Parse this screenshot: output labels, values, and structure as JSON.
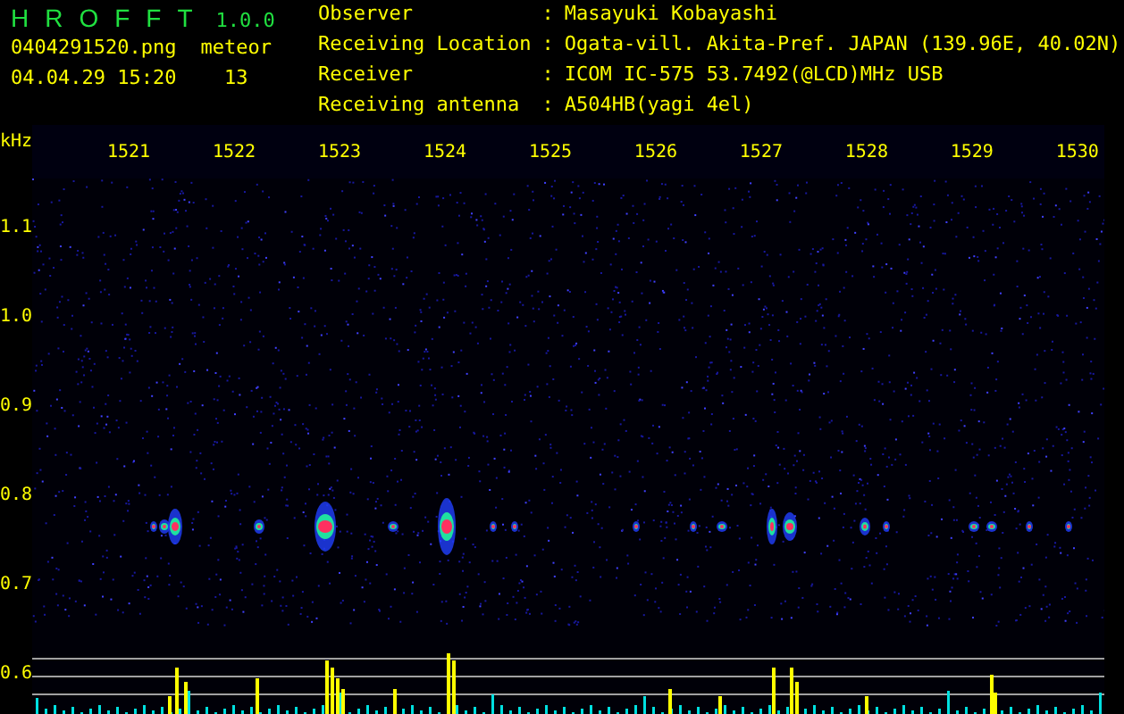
{
  "app": {
    "title": "HROFFT",
    "version": "1.0.0"
  },
  "file": {
    "name": "0404291520.png",
    "datetime": "04.04.29 15:20"
  },
  "meteor": {
    "label": "meteor",
    "count": "13"
  },
  "info": [
    {
      "label": "Observer",
      "separator": ":",
      "value": "Masayuki Kobayashi"
    },
    {
      "label": "Receiving Location",
      "separator": ":",
      "value": "Ogata-vill. Akita-Pref. JAPAN (139.96E, 40.02N)"
    },
    {
      "label": "Receiver",
      "separator": ":",
      "value": "ICOM IC-575 53.7492(@LCD)MHz USB"
    },
    {
      "label": "Receiving antenna",
      "separator": ":",
      "value": "A504HB(yagi 4el)"
    }
  ],
  "plot": {
    "unit": "kHz",
    "x_labels": [
      "1521",
      "1522",
      "1523",
      "1524",
      "1525",
      "1526",
      "1527",
      "1528",
      "1529",
      "1530"
    ],
    "y_labels": [
      "1.1",
      "1.0",
      "0.9",
      "0.8",
      "0.7",
      "0.6"
    ]
  }
}
